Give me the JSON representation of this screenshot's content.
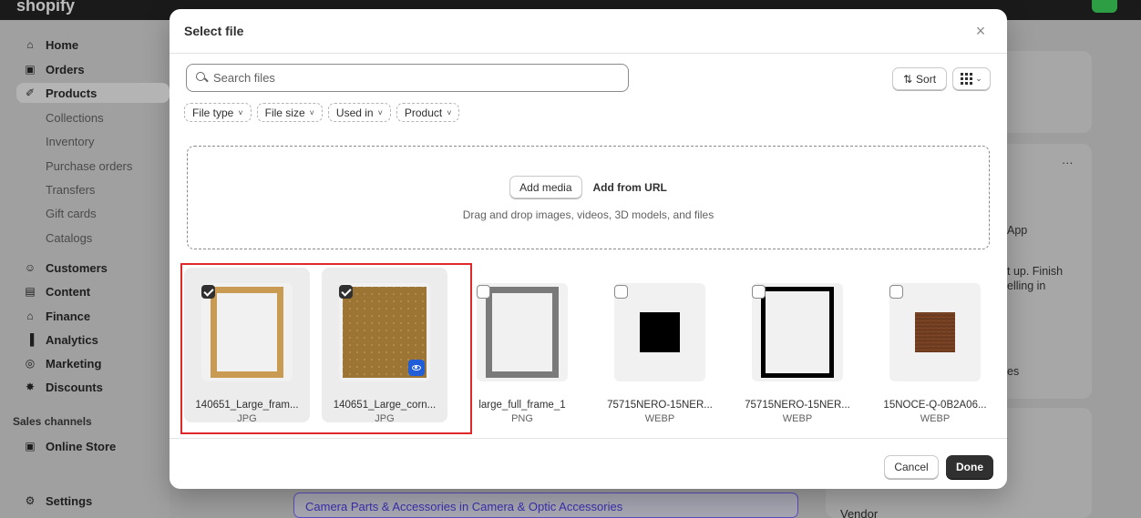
{
  "app": {
    "logo": "shopify"
  },
  "sidebar": {
    "items": [
      {
        "label": "Home",
        "icon": "home-icon",
        "glyph": "⌂",
        "type": "main"
      },
      {
        "label": "Orders",
        "icon": "orders-icon",
        "glyph": "▣",
        "type": "main"
      },
      {
        "label": "Products",
        "icon": "tag-icon",
        "glyph": "✐",
        "type": "main",
        "active": true
      },
      {
        "label": "Collections",
        "type": "sub"
      },
      {
        "label": "Inventory",
        "type": "sub"
      },
      {
        "label": "Purchase orders",
        "type": "sub"
      },
      {
        "label": "Transfers",
        "type": "sub"
      },
      {
        "label": "Gift cards",
        "type": "sub"
      },
      {
        "label": "Catalogs",
        "type": "sub"
      },
      {
        "label": "Customers",
        "icon": "person-icon",
        "glyph": "☺",
        "type": "main"
      },
      {
        "label": "Content",
        "icon": "content-icon",
        "glyph": "▤",
        "type": "main"
      },
      {
        "label": "Finance",
        "icon": "bank-icon",
        "glyph": "⌂",
        "type": "main"
      },
      {
        "label": "Analytics",
        "icon": "bar-chart-icon",
        "glyph": "▐",
        "type": "main"
      },
      {
        "label": "Marketing",
        "icon": "target-icon",
        "glyph": "◎",
        "type": "main"
      },
      {
        "label": "Discounts",
        "icon": "discount-icon",
        "glyph": "✸",
        "type": "main"
      }
    ],
    "sales_channels_label": "Sales channels",
    "online_store": "Online Store",
    "settings": "Settings"
  },
  "background": {
    "category_value": "Camera Parts & Accessories in Camera & Optic Accessories",
    "vendor_label": "Vendor",
    "side_texts": [
      "App",
      "t up. Finish",
      "elling in",
      "es"
    ],
    "more_menu": "···"
  },
  "modal": {
    "title": "Select file",
    "close_glyph": "×",
    "search": {
      "placeholder": "Search files",
      "value": ""
    },
    "sort_label": "Sort",
    "sort_glyph": "⇅",
    "filters": [
      "File type",
      "File size",
      "Used in",
      "Product"
    ],
    "dropzone": {
      "add_media": "Add media",
      "add_from_url": "Add from URL",
      "hint": "Drag and drop images, videos, 3D models, and files"
    },
    "files": [
      {
        "name": "140651_Large_fram...",
        "type": "JPG",
        "checked": true,
        "thumb": "gold-frame"
      },
      {
        "name": "140651_Large_corn...",
        "type": "JPG",
        "checked": true,
        "thumb": "gold-texture",
        "preview_badge": true
      },
      {
        "name": "large_full_frame_1",
        "type": "PNG",
        "checked": false,
        "thumb": "gray-frame"
      },
      {
        "name": "75715NERO-15NER...",
        "type": "WEBP",
        "checked": false,
        "thumb": "black-square"
      },
      {
        "name": "75715NERO-15NER...",
        "type": "WEBP",
        "checked": false,
        "thumb": "black-frame"
      },
      {
        "name": "15NOCE-Q-0B2A06...",
        "type": "WEBP",
        "checked": false,
        "thumb": "walnut-square"
      }
    ],
    "cancel_label": "Cancel",
    "done_label": "Done"
  },
  "colors": {
    "primary_button": "#303030",
    "highlight": "#e0282a",
    "preview_badge": "#1f5ed8",
    "gold": "#c99a52",
    "walnut": "#6b3a1f"
  }
}
